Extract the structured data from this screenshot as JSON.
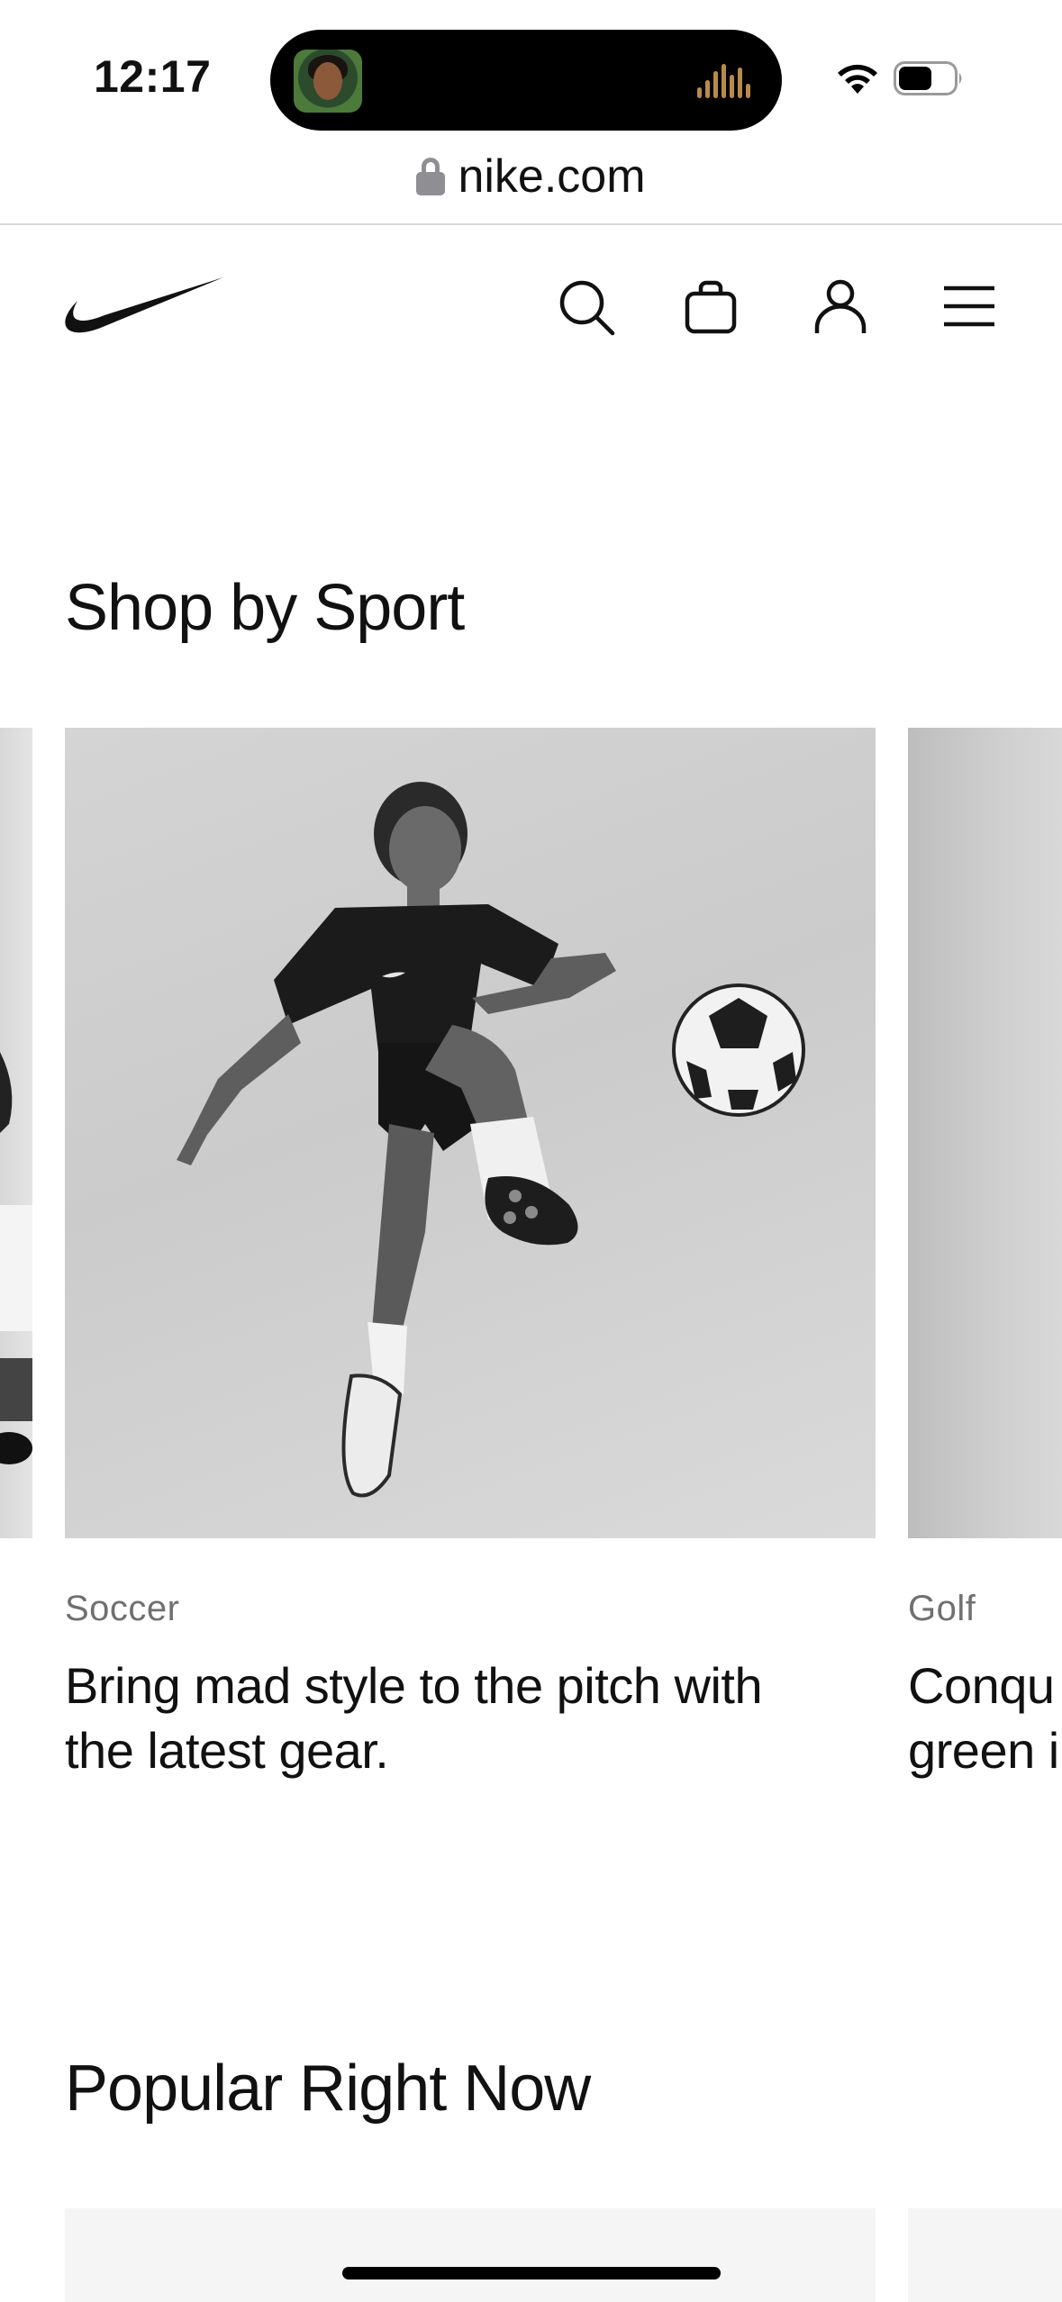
{
  "status_bar": {
    "time": "12:17"
  },
  "browser": {
    "url": "nike.com"
  },
  "header": {
    "logo_icon": "nike-swoosh",
    "search_icon": "search-icon",
    "bag_icon": "bag-icon",
    "account_icon": "user-icon",
    "menu_icon": "hamburger-menu-icon"
  },
  "shop_by_sport": {
    "title": "Shop by Sport",
    "cards": [
      {
        "category": "Soccer",
        "headline": "Bring mad style to the pitch with the latest gear."
      },
      {
        "category": "Golf",
        "headline_line1": "Conqu",
        "headline_line2": "green i"
      }
    ]
  },
  "popular": {
    "title": "Popular Right Now"
  },
  "colors": {
    "text": "#111111",
    "muted": "#707072",
    "divider": "#d8d8d8",
    "tile_bg": "#f5f5f5"
  }
}
